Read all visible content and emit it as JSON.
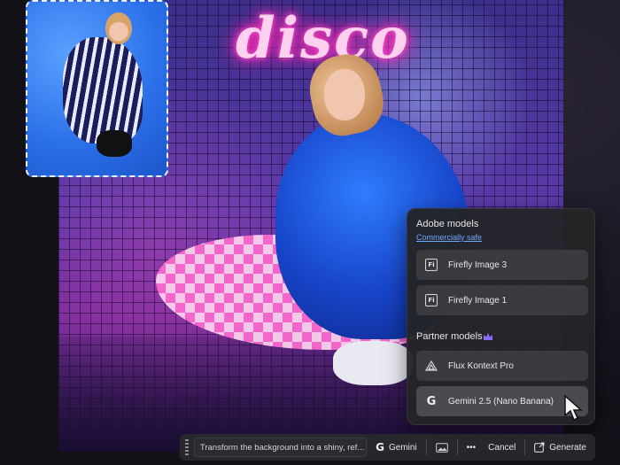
{
  "canvas": {
    "neon_text": "disco"
  },
  "picker": {
    "adobe_section_title": "Adobe models",
    "adobe_section_subtitle": "Commercially safe",
    "adobe_models": [
      {
        "label": "Firefly Image 3",
        "icon": "firefly-icon"
      },
      {
        "label": "Firefly Image 1",
        "icon": "firefly-icon"
      }
    ],
    "partner_section_title": "Partner models",
    "partner_badge_icon": "crown-icon",
    "partner_models": [
      {
        "label": "Flux Kontext Pro",
        "icon": "flux-triangle-icon"
      },
      {
        "label": "Gemini 2.5 (Nano Banana)",
        "icon": "google-g-icon"
      }
    ]
  },
  "prompt_bar": {
    "prompt_text": "Transform the background into a shiny, ref...",
    "model_label": "Gemini",
    "more_label": "•••",
    "cancel_label": "Cancel",
    "generate_label": "Generate"
  },
  "colors": {
    "accent_link": "#6fa6ff",
    "crown": "#8b6cff",
    "panel_bg": "#242428"
  }
}
